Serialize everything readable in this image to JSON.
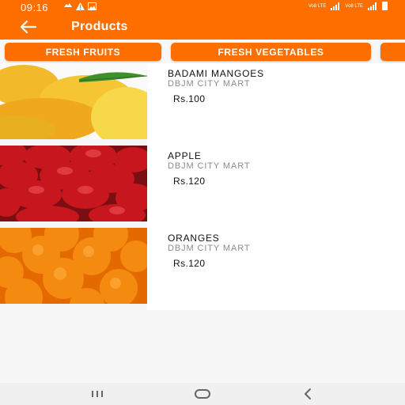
{
  "status_bar": {
    "time": "09:16",
    "left_icons": [
      "whatsapp-icon",
      "warning-icon",
      "image-icon"
    ],
    "right_small_text_1": "Vo8 LTE",
    "right_small_text_2": "Vo8 LTE"
  },
  "header": {
    "title": "Products",
    "back_icon": "arrow-left-icon"
  },
  "categories": [
    "FRESH FRUITS",
    "FRESH VEGETABLES",
    ""
  ],
  "products": [
    {
      "name": "BADAMI MANGOES",
      "store": "DBJM CITY MART",
      "price": "Rs.100",
      "image": "mangoes-image"
    },
    {
      "name": "APPLE",
      "store": "DBJM CITY MART",
      "price": "Rs.120",
      "image": "apples-image"
    },
    {
      "name": "ORANGES",
      "store": "DBJM CITY MART",
      "price": "Rs.120",
      "image": "oranges-image"
    }
  ],
  "nav_bar": {
    "recents_icon": "recents-icon",
    "home_icon": "home-icon",
    "back_icon": "back-triangle-icon"
  },
  "colors": {
    "accent": "#ff6f00",
    "background": "#f7f7f7",
    "text_primary": "#111111",
    "text_secondary": "#8a8a8a"
  }
}
